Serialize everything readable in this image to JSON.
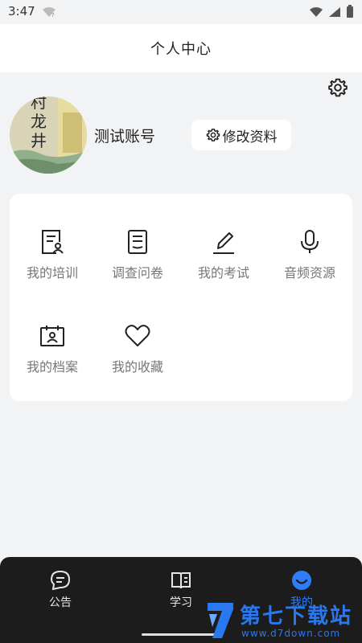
{
  "status_bar": {
    "time": "3:47"
  },
  "header": {
    "title": "个人中心"
  },
  "profile": {
    "username": "测试账号",
    "edit_label": "修改资料",
    "avatar_text": "村龙井"
  },
  "menu": {
    "items": [
      {
        "label": "我的培训",
        "icon": "training-icon"
      },
      {
        "label": "调查问卷",
        "icon": "survey-icon"
      },
      {
        "label": "我的考试",
        "icon": "exam-pen-icon"
      },
      {
        "label": "音频资源",
        "icon": "microphone-icon"
      },
      {
        "label": "我的档案",
        "icon": "archive-icon"
      },
      {
        "label": "我的收藏",
        "icon": "heart-icon"
      }
    ]
  },
  "bottom_nav": {
    "items": [
      {
        "label": "公告",
        "icon": "chat-bubble-icon",
        "active": false
      },
      {
        "label": "学习",
        "icon": "book-icon",
        "active": false
      },
      {
        "label": "我的",
        "icon": "smile-icon",
        "active": true
      }
    ]
  },
  "watermark": {
    "title": "第七下载站",
    "url": "www.d7down.com"
  },
  "colors": {
    "accent": "#2f7df6",
    "nav_bg": "#1c1c1c",
    "page_bg": "#f2f3f5"
  }
}
